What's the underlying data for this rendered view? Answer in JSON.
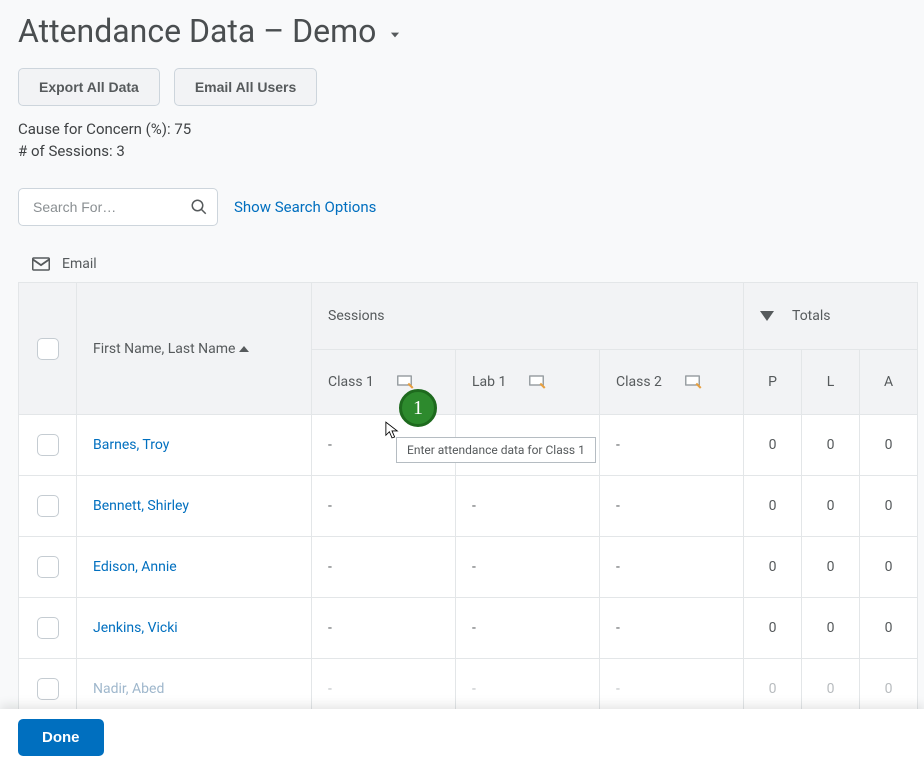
{
  "header": {
    "title": "Attendance Data – Demo"
  },
  "buttons": {
    "export": "Export All Data",
    "email_all": "Email All Users",
    "done": "Done"
  },
  "info": {
    "concern_label": "Cause for Concern (%): 75",
    "sessions_label": "# of Sessions: 3"
  },
  "search": {
    "placeholder": "Search For…",
    "show_options": "Show Search Options"
  },
  "toolbar": {
    "email_label": "Email"
  },
  "table": {
    "name_header": "First Name, Last Name",
    "sessions_header": "Sessions",
    "totals_header": "Totals",
    "session_cols": [
      "Class 1",
      "Lab 1",
      "Class 2"
    ],
    "total_cols": [
      "P",
      "L",
      "A"
    ],
    "rows": [
      {
        "name": "Barnes, Troy",
        "s": [
          "-",
          "-",
          "-"
        ],
        "t": [
          "0",
          "0",
          "0"
        ]
      },
      {
        "name": "Bennett, Shirley",
        "s": [
          "-",
          "-",
          "-"
        ],
        "t": [
          "0",
          "0",
          "0"
        ]
      },
      {
        "name": "Edison, Annie",
        "s": [
          "-",
          "-",
          "-"
        ],
        "t": [
          "0",
          "0",
          "0"
        ]
      },
      {
        "name": "Jenkins, Vicki",
        "s": [
          "-",
          "-",
          "-"
        ],
        "t": [
          "0",
          "0",
          "0"
        ]
      },
      {
        "name": "Nadir, Abed",
        "s": [
          "-",
          "-",
          "-"
        ],
        "t": [
          "0",
          "0",
          "0"
        ]
      }
    ]
  },
  "tooltip": {
    "text": "Enter attendance data for Class 1"
  },
  "badge": {
    "label": "1"
  }
}
